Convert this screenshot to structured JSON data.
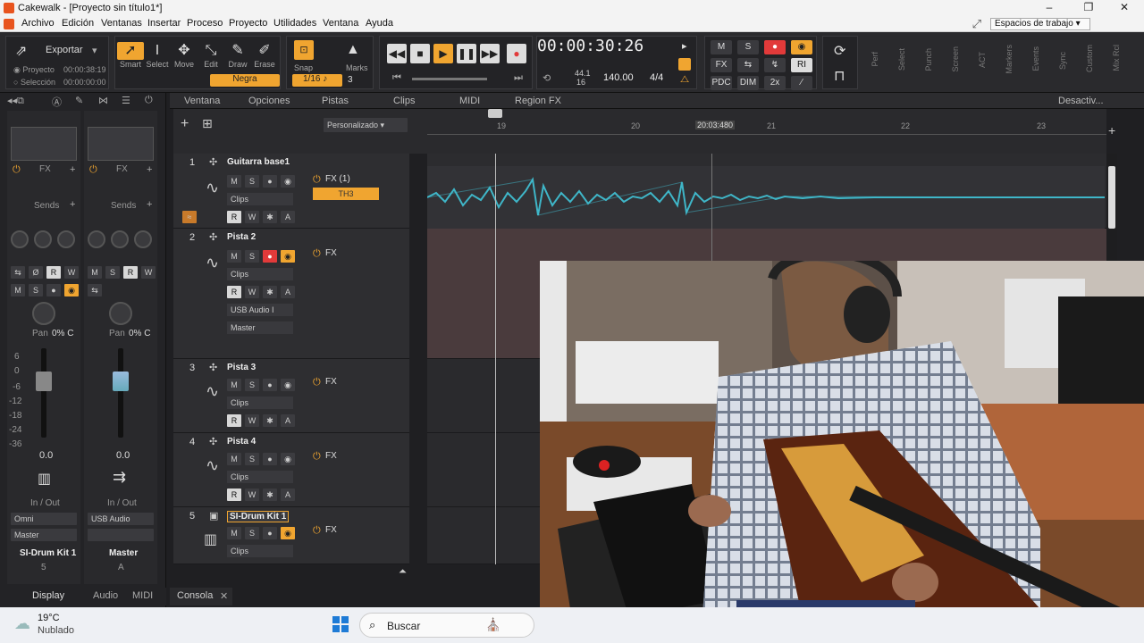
{
  "window": {
    "title": "Cakewalk - [Proyecto sin título1*]"
  },
  "menu": {
    "items": [
      "Archivo",
      "Edición",
      "Ventanas",
      "Insertar",
      "Proceso",
      "Proyecto",
      "Utilidades",
      "Ventana",
      "Ayuda"
    ],
    "workspace": "Espacios de trabajo"
  },
  "control": {
    "export": "Exportar",
    "project_label": "Proyecto",
    "project_time": "00:00:38:19",
    "selection_label": "Selección",
    "selection_time": "00:00:00:00",
    "tools": [
      "Smart",
      "Select",
      "Move",
      "Edit",
      "Draw",
      "Erase"
    ],
    "snap": "Snap",
    "snap_value": "1/16",
    "snap_mode": "Negra",
    "snap_count": "3",
    "marks": "Marks",
    "time": "00:00:30:26",
    "sample_rate": "44.1",
    "bit_depth": "16",
    "tempo": "140.00",
    "meter": "4/4",
    "mix_buttons": [
      "M",
      "S",
      "FX",
      "PDC",
      "DIM",
      "2x",
      "RI"
    ],
    "modules": [
      "Perf",
      "Select",
      "Punch",
      "Screen",
      "ACT",
      "Markers",
      "Events",
      "Sync",
      "Custom",
      "Mix Rcl"
    ]
  },
  "inspector": {
    "strip_a": {
      "fx": "FX",
      "sends": "Sends",
      "pan": "Pan",
      "pan_val": "0% C",
      "vol": "0.0",
      "io": "In / Out",
      "input": "Omni",
      "output": "Master",
      "name": "SI-Drum Kit 1",
      "num": "5"
    },
    "strip_b": {
      "fx": "FX",
      "sends": "Sends",
      "pan": "Pan",
      "pan_val": "0% C",
      "vol": "0.0",
      "io": "In / Out",
      "input": "USB Audio",
      "output": "",
      "name": "Master",
      "num": "A"
    },
    "db_scale": [
      "6",
      "0",
      "-6",
      "-12",
      "-18",
      "-24",
      "-36"
    ],
    "tabs": [
      "Display",
      "Audio",
      "MIDI"
    ]
  },
  "trackmenu": {
    "items": [
      "Ventana",
      "Opciones",
      "Pistas",
      "Clips",
      "MIDI",
      "Region FX"
    ],
    "preset": "Personalizado",
    "deact": "Desactiv..."
  },
  "ruler": {
    "ticks": [
      "19",
      "20",
      "21",
      "22",
      "23"
    ],
    "marker": "20:03:480"
  },
  "tracks": [
    {
      "num": "1",
      "name": "Guitarra base1",
      "fx": "FX (1)",
      "plugin": "TH3",
      "clips": "Clips"
    },
    {
      "num": "2",
      "name": "Pista 2",
      "fx": "FX",
      "clips": "Clips",
      "input": "USB Audio I",
      "output": "Master"
    },
    {
      "num": "3",
      "name": "Pista 3",
      "fx": "FX",
      "clips": "Clips"
    },
    {
      "num": "4",
      "name": "Pista 4",
      "fx": "FX",
      "clips": "Clips"
    },
    {
      "num": "5",
      "name": "SI-Drum Kit 1",
      "fx": "FX",
      "clips": "Clips"
    }
  ],
  "console_tab": "Consola",
  "taskbar": {
    "temp": "19°C",
    "weather": "Nublado",
    "search": "Buscar"
  },
  "colors": {
    "accent": "#f0a530",
    "waveform": "#3fb6c8",
    "record": "#e23a3a"
  }
}
